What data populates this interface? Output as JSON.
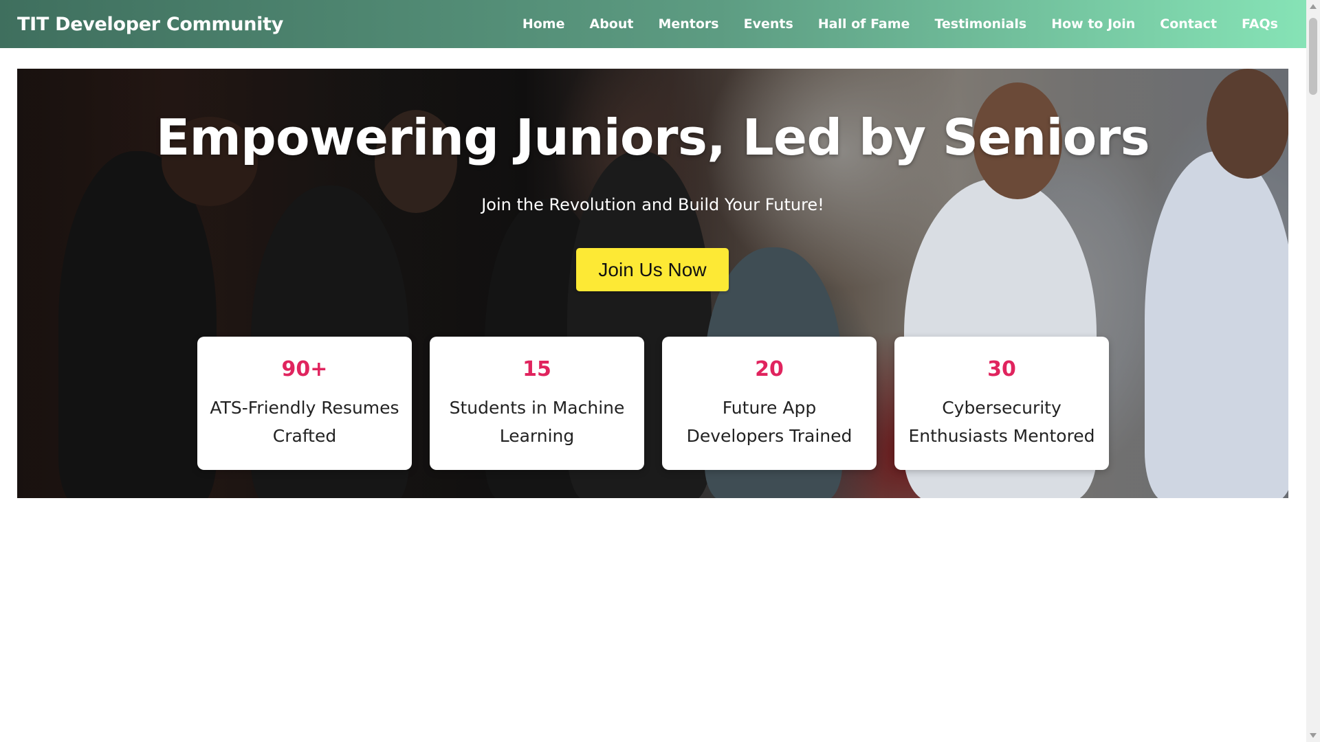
{
  "navbar": {
    "brand": "TIT Developer Community",
    "links": [
      {
        "label": "Home"
      },
      {
        "label": "About"
      },
      {
        "label": "Mentors"
      },
      {
        "label": "Events"
      },
      {
        "label": "Hall of Fame"
      },
      {
        "label": "Testimonials"
      },
      {
        "label": "How to Join"
      },
      {
        "label": "Contact"
      },
      {
        "label": "FAQs"
      }
    ]
  },
  "hero": {
    "title": "Empowering Juniors, Led by Seniors",
    "subtitle": "Join the Revolution and Build Your Future!",
    "cta_label": "Join Us Now",
    "stats": [
      {
        "number": "90+",
        "label": "ATS-Friendly Resumes Crafted"
      },
      {
        "number": "15",
        "label": "Students in Machine Learning"
      },
      {
        "number": "20",
        "label": "Future App Developers Trained"
      },
      {
        "number": "30",
        "label": "Cybersecurity Enthusiasts Mentored"
      }
    ]
  },
  "colors": {
    "accent_number": "#e0245e",
    "cta_background": "#fde935",
    "navbar_gradient_start": "#3f6f5e",
    "navbar_gradient_end": "#86e3b6"
  }
}
